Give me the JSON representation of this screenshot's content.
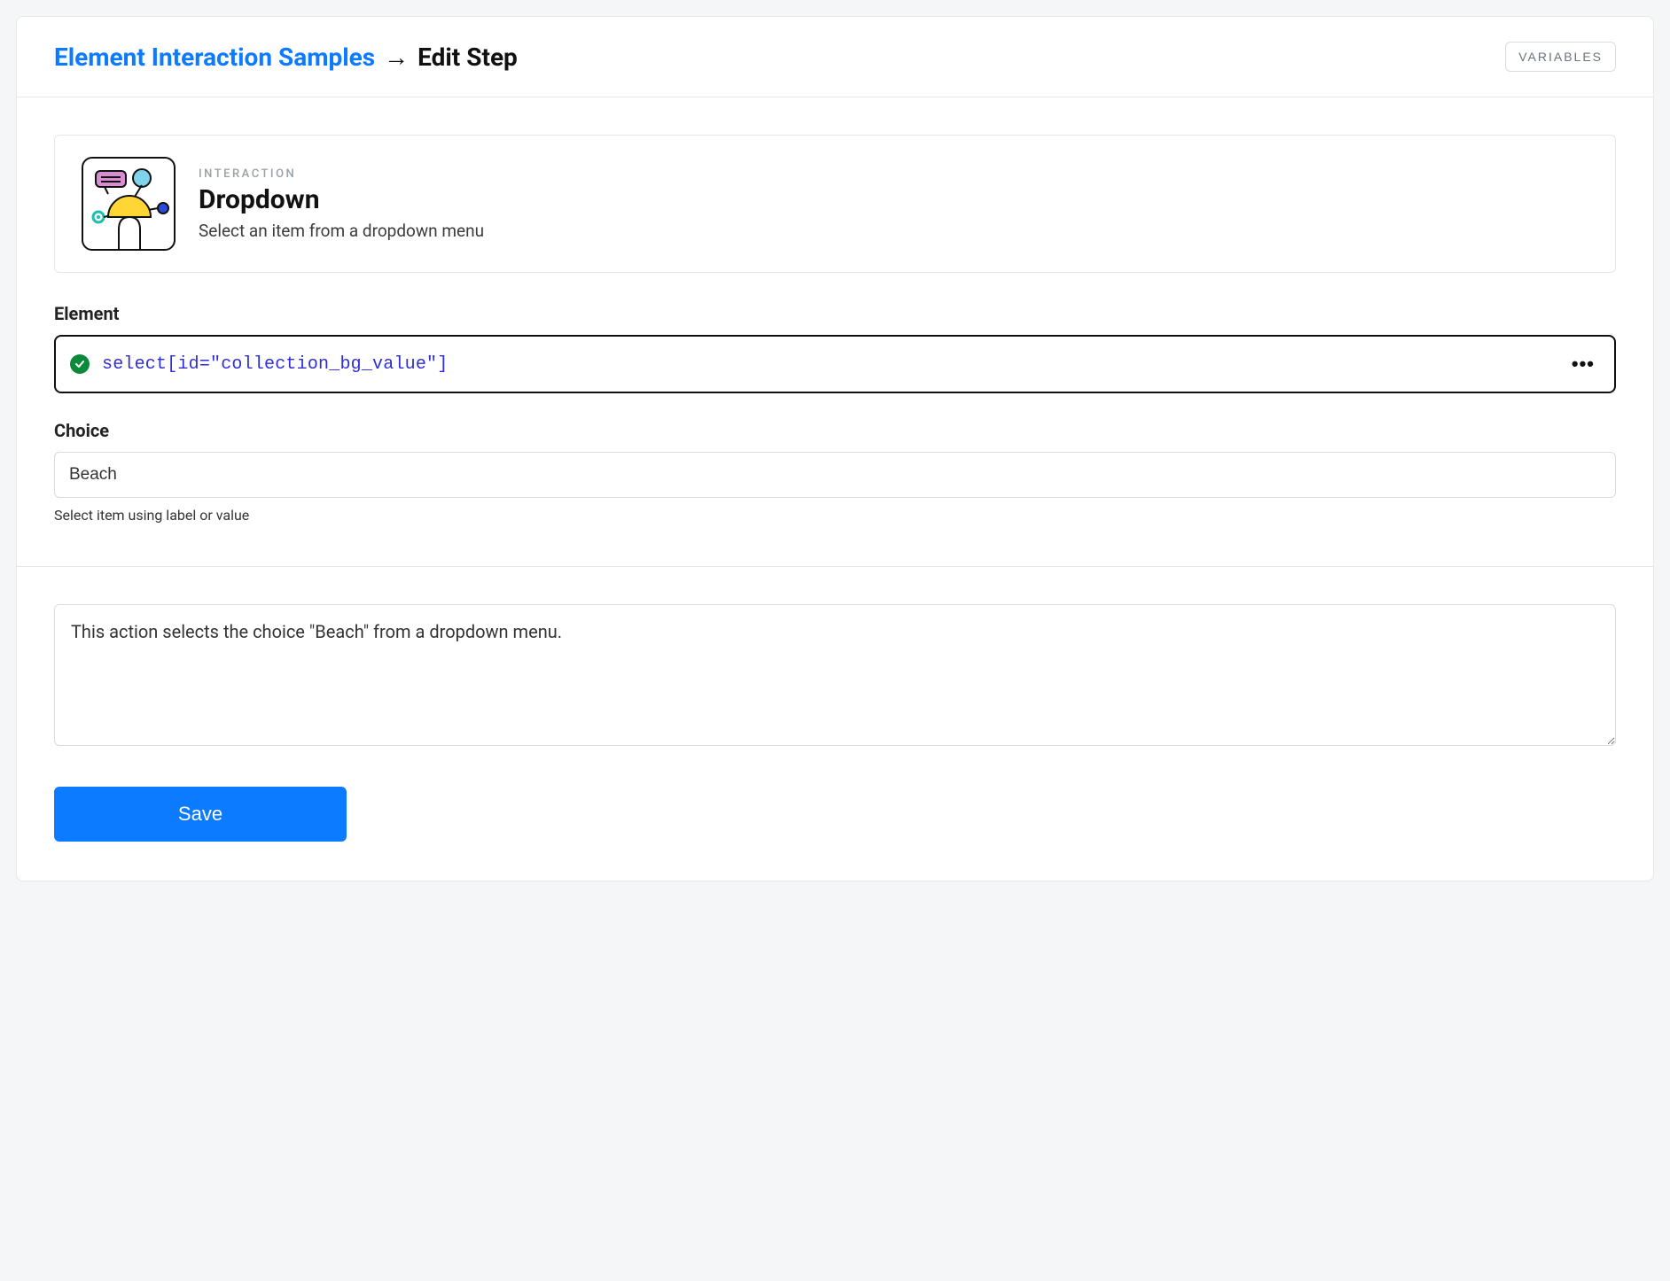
{
  "header": {
    "breadcrumb_link": "Element Interaction Samples",
    "breadcrumb_separator": "→",
    "breadcrumb_current": "Edit Step",
    "variables_button": "VARIABLES"
  },
  "interaction": {
    "eyebrow": "INTERACTION",
    "title": "Dropdown",
    "subtitle": "Select an item from a dropdown menu"
  },
  "element_field": {
    "label": "Element",
    "selector": "select[id=\"collection_bg_value\"]",
    "status": "valid",
    "more_label": "•••"
  },
  "choice_field": {
    "label": "Choice",
    "value": "Beach",
    "helper": "Select item using label or value"
  },
  "description": {
    "value": "This action selects the choice \"Beach\" from a dropdown menu."
  },
  "actions": {
    "save": "Save"
  }
}
